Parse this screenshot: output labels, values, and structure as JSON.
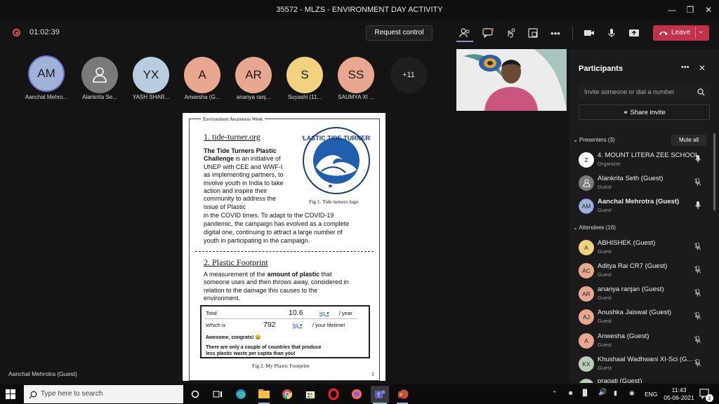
{
  "window": {
    "title": "35572 - MLZS - ENVIRONMENT DAY ACTIVITY"
  },
  "meeting": {
    "timer": "01:02:39",
    "request_control": "Request control",
    "leave": "Leave"
  },
  "toolbar_icons": [
    "people-icon",
    "chat-icon",
    "reactions-icon",
    "rooms-icon",
    "more-icon",
    "camera-icon",
    "mic-icon",
    "share-icon"
  ],
  "gallery": [
    {
      "initials": "AM",
      "name": "Aanchal Mehro...",
      "color": "#9fb3d9"
    },
    {
      "initials": "",
      "name": "Alankrita Se...",
      "color": "#7a7a7a"
    },
    {
      "initials": "YX",
      "name": "YASH SHAR...",
      "color": "#b8cde0"
    },
    {
      "initials": "A",
      "name": "Anwesha (G...",
      "color": "#e7a88f"
    },
    {
      "initials": "AR",
      "name": "ananya ranj...",
      "color": "#e7a88f"
    },
    {
      "initials": "S",
      "name": "Suyashi (11...",
      "color": "#f1d27f"
    },
    {
      "initials": "SS",
      "name": "SAUMYA XI ...",
      "color": "#e7a88f"
    }
  ],
  "overflow": "+11",
  "presenter_caption": "Aanchal Mehrotra (Guest)",
  "slide": {
    "header": "Environment Awareness Week",
    "s1_title": "1. tide-turner.org",
    "s1_bold": "The Tide Turners Plastic Challenge",
    "s1_l1": "is an initiative of",
    "s1_l2": "UNEP with CEE and WWF-I",
    "s1_l3": "as implementing partners, to",
    "s1_l4": "involve youth in India to take",
    "s1_l5": "action and inspire their",
    "s1_l6": "community to address the",
    "s1_l7": "issue of Plastic",
    "s1_l8": "in the COVID times. To adapt to the COVID-19",
    "s1_l9": "pandemic, the campaign has evolved as a complete",
    "s1_l10": "digital one, continuing to attract a large number of",
    "s1_l11": "youth in participating in the campaign.",
    "logo_text": "PLASTIC TIDE TURNERS",
    "fig1": "Fig 1. Tide turners logo",
    "s2_title": "2. Plastic Footprint",
    "s2_l1a": "A measurement of the",
    "s2_l1b": "amount of plastic",
    "s2_l1c": "that",
    "s2_l2": "someone uses and then throws away, considered in",
    "s2_l3": "relation to the damage this causes to the",
    "s2_l4": "environment.",
    "fp_total_label": "Total",
    "fp_total_value": "10.6",
    "fp_total_unit": "kg",
    "fp_total_per": "/ year",
    "fp_which_label": "Which is",
    "fp_which_value": "792",
    "fp_which_unit": "kg",
    "fp_which_per": "/ your lifetime!",
    "fp_congrats": "Awesome, congrats! 😄",
    "fp_note1": "There are only a couple of countries that produce",
    "fp_note2": "less plastic waste per capita than you!",
    "fig2": "Fig 2. My Plastic Footprint",
    "page": "1"
  },
  "panel": {
    "title": "Participants",
    "invite_placeholder": "Invite someone or dial a number",
    "share_invite": "Share invite",
    "presenters_header": "Presenters (3)",
    "mute_all": "Mute all",
    "attendees_header": "Attendees (16)",
    "presenters": [
      {
        "initials": "Z",
        "name": "4. MOUNT LITERA ZEE SCHOOL",
        "role": "Organizer",
        "color": "#ffffff",
        "mic": "on"
      },
      {
        "initials": "",
        "name": "Alankrita Seth (Guest)",
        "role": "Guest",
        "color": "#7a7a7a",
        "mic": "off"
      },
      {
        "initials": "AM",
        "name": "Aanchal Mehrotra (Guest)",
        "role": "Guest",
        "color": "#9fb3d9",
        "mic": "on"
      }
    ],
    "attendees": [
      {
        "initials": "A",
        "name": "ABHISHEK (Guest)",
        "role": "Guest",
        "color": "#f1d27f"
      },
      {
        "initials": "AC",
        "name": "Aditya Rai CR7 (Guest)",
        "role": "Guest",
        "color": "#e7a88f"
      },
      {
        "initials": "AR",
        "name": "ananya ranjan (Guest)",
        "role": "Guest",
        "color": "#e7a88f"
      },
      {
        "initials": "AJ",
        "name": "Anushka Jaiswal (Guest)",
        "role": "Guest",
        "color": "#e7a88f"
      },
      {
        "initials": "A",
        "name": "Anwesha (Guest)",
        "role": "Guest",
        "color": "#e7a88f"
      },
      {
        "initials": "KX",
        "name": "Khushaal Wadhwani XI-Sci (G...",
        "role": "Guest",
        "color": "#b9cfb5"
      },
      {
        "initials": "",
        "name": "pragati (Guest)",
        "role": "",
        "color": "#b9cfb5"
      }
    ]
  },
  "taskbar": {
    "search_placeholder": "Type here to search",
    "lang": "ENG",
    "time": "11:43",
    "date": "05-06-2021",
    "notif_count": "2"
  }
}
